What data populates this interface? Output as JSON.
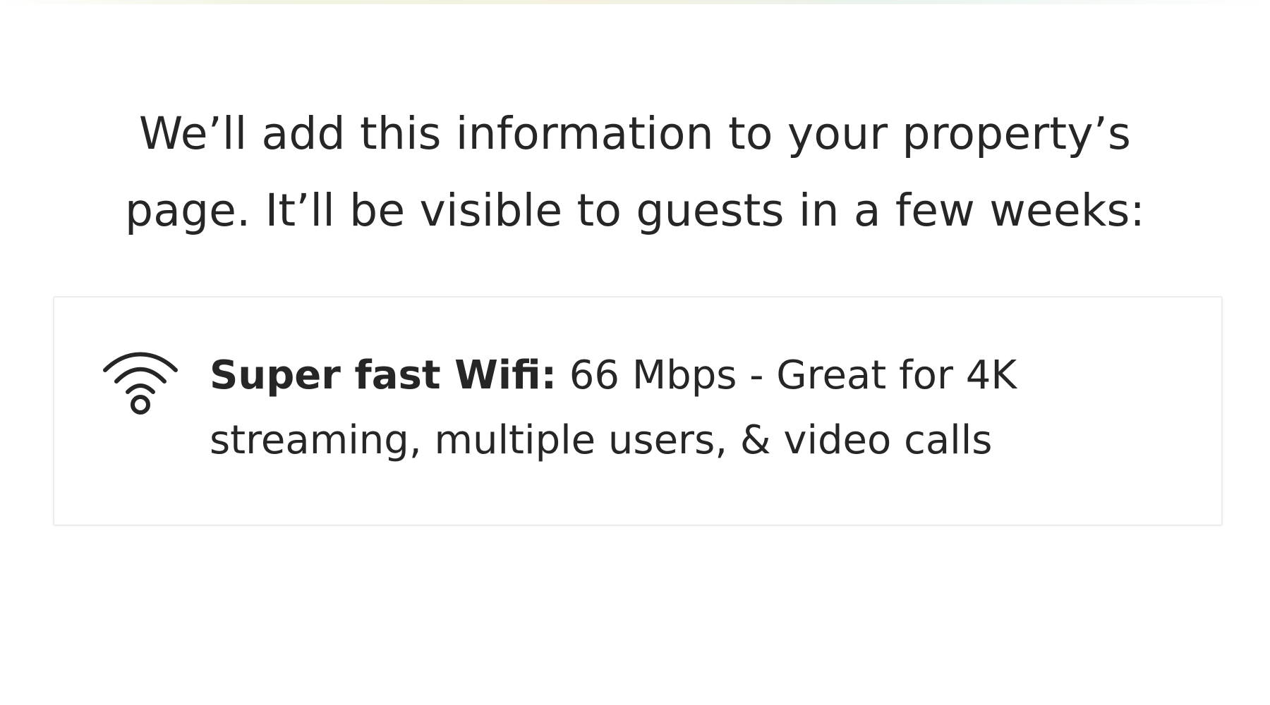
{
  "intro": {
    "text": "We’ll add this information to your property’s page. It’ll be visible to guests in a few weeks:"
  },
  "amenity": {
    "icon": "wifi-icon",
    "title": "Super fast Wifi:",
    "description": " 66 Mbps - Great for 4K streaming, multiple users, & video calls"
  }
}
